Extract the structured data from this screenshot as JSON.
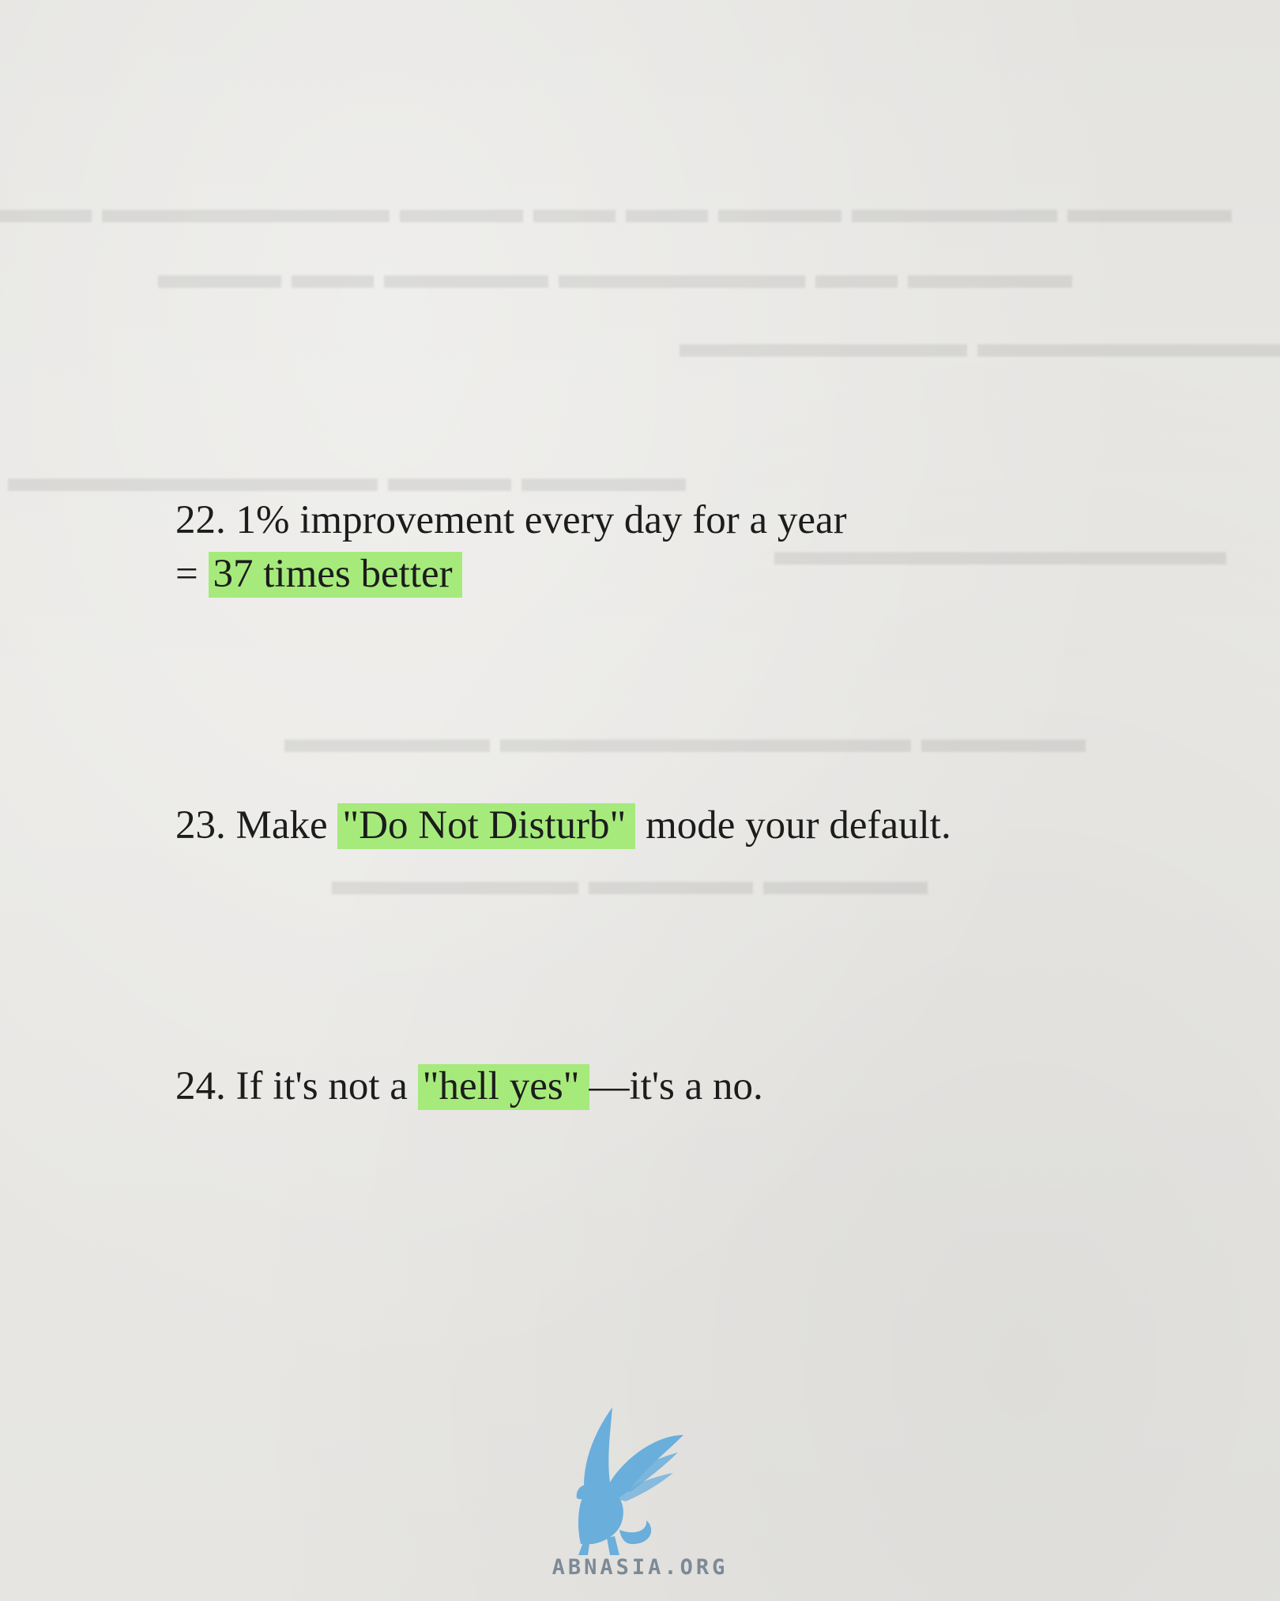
{
  "items": [
    {
      "number": "22.",
      "line1": "1% improvement every day for a year",
      "prefix2": "=",
      "highlight": "37 times better"
    },
    {
      "number": "23.",
      "before": "Make",
      "highlight": "\"Do Not Disturb\"",
      "after": "mode your default."
    },
    {
      "number": "24.",
      "before": "If it's not a",
      "highlight": "\"hell yes\"",
      "after": "—it's a no."
    }
  ],
  "brand": {
    "logo": "griffin-logo",
    "text": "ABNASIA.ORG"
  },
  "colors": {
    "highlight": "#a6ea7c",
    "text": "#1c1c1c",
    "logo": "#6aaedc",
    "paper": "#e6e5e2"
  }
}
